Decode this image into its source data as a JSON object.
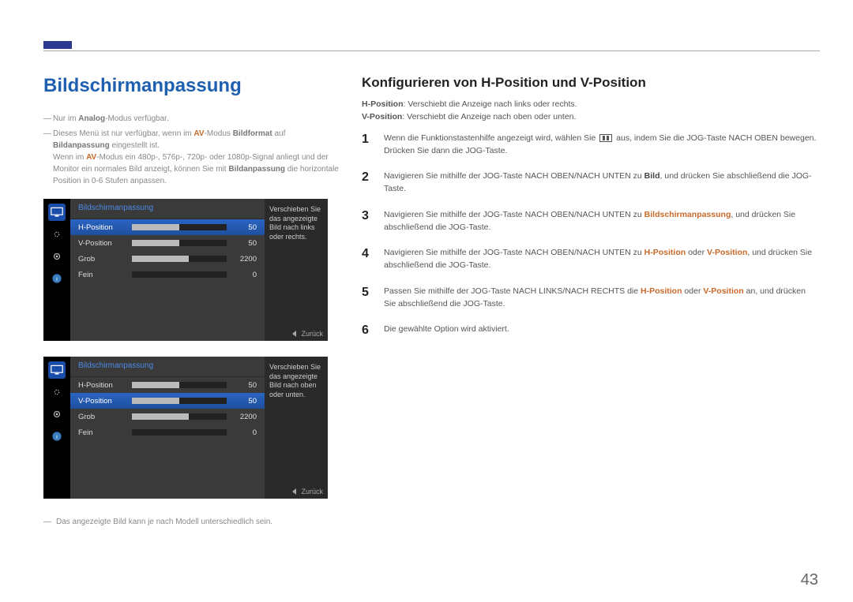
{
  "page_number": "43",
  "left": {
    "title": "Bildschirmanpassung",
    "note1": "Nur im ",
    "note1_b": "Analog",
    "note1_after": "-Modus verfügbar.",
    "note2_pre": "Dieses Menü ist nur verfügbar, wenn im ",
    "note2_av": "AV",
    "note2_mid": "-Modus ",
    "note2_bildformat": "Bildformat",
    "note2_auf": " auf ",
    "note2_bildanpassung": "Bildanpassung",
    "note2_eingestellt": " eingestellt ist.",
    "note2_line2a": "Wenn im ",
    "note2_line2_av": "AV",
    "note2_line2b": "-Modus ein 480p-, 576p-, 720p- oder 1080p-Signal anliegt und der Monitor ein normales Bild anzeigt, können Sie mit ",
    "note2_line2_bild": "Bildanpassung",
    "note2_line2c": " die horizontale Position in 0-6 Stufen anpassen.",
    "footnote": "Das angezeigte Bild kann je nach Modell unterschiedlich sein."
  },
  "osd_common": {
    "title": "Bildschirmanpassung",
    "rows": [
      {
        "label": "H-Position",
        "value": "50",
        "fill": 50
      },
      {
        "label": "V-Position",
        "value": "50",
        "fill": 50
      },
      {
        "label": "Grob",
        "value": "2200",
        "fill": 60
      },
      {
        "label": "Fein",
        "value": "0",
        "fill": 0
      }
    ],
    "back": "Zurück"
  },
  "osd1_help": "Verschieben Sie das angezeigte Bild nach links oder rechts.",
  "osd2_help": "Verschieben Sie das angezeigte Bild nach oben oder unten.",
  "right": {
    "title": "Konfigurieren von H-Position und V-Position",
    "desc_hpos_label": "H-Position",
    "desc_hpos": ": Verschiebt die Anzeige nach links oder rechts.",
    "desc_vpos_label": "V-Position",
    "desc_vpos": ": Verschiebt die Anzeige nach oben oder unten.",
    "steps": [
      {
        "n": "1",
        "pre": "Wenn die Funktionstastenhilfe angezeigt wird, wählen Sie ",
        "post": " aus, indem Sie die JOG-Taste NACH OBEN bewegen. Drücken Sie dann die JOG-Taste."
      },
      {
        "n": "2",
        "pre": "Navigieren Sie mithilfe der JOG-Taste NACH OBEN/NACH UNTEN zu ",
        "b": "Bild",
        "post": ", und drücken Sie abschließend die JOG-Taste."
      },
      {
        "n": "3",
        "pre": "Navigieren Sie mithilfe der JOG-Taste NACH OBEN/NACH UNTEN zu ",
        "o": "Bildschirmanpassung",
        "post": ", und drücken Sie abschließend die JOG-Taste."
      },
      {
        "n": "4",
        "pre": "Navigieren Sie mithilfe der JOG-Taste NACH OBEN/NACH UNTEN zu ",
        "o": "H-Position",
        "mid": " oder ",
        "o2": "V-Position",
        "post": ", und drücken Sie abschließend die JOG-Taste."
      },
      {
        "n": "5",
        "pre": "Passen Sie mithilfe der JOG-Taste NACH LINKS/NACH RECHTS die ",
        "o": "H-Position",
        "mid": " oder ",
        "o2": "V-Position",
        "post": " an, und drücken Sie abschließend die JOG-Taste."
      },
      {
        "n": "6",
        "pre": "Die gewählte Option wird aktiviert."
      }
    ]
  }
}
